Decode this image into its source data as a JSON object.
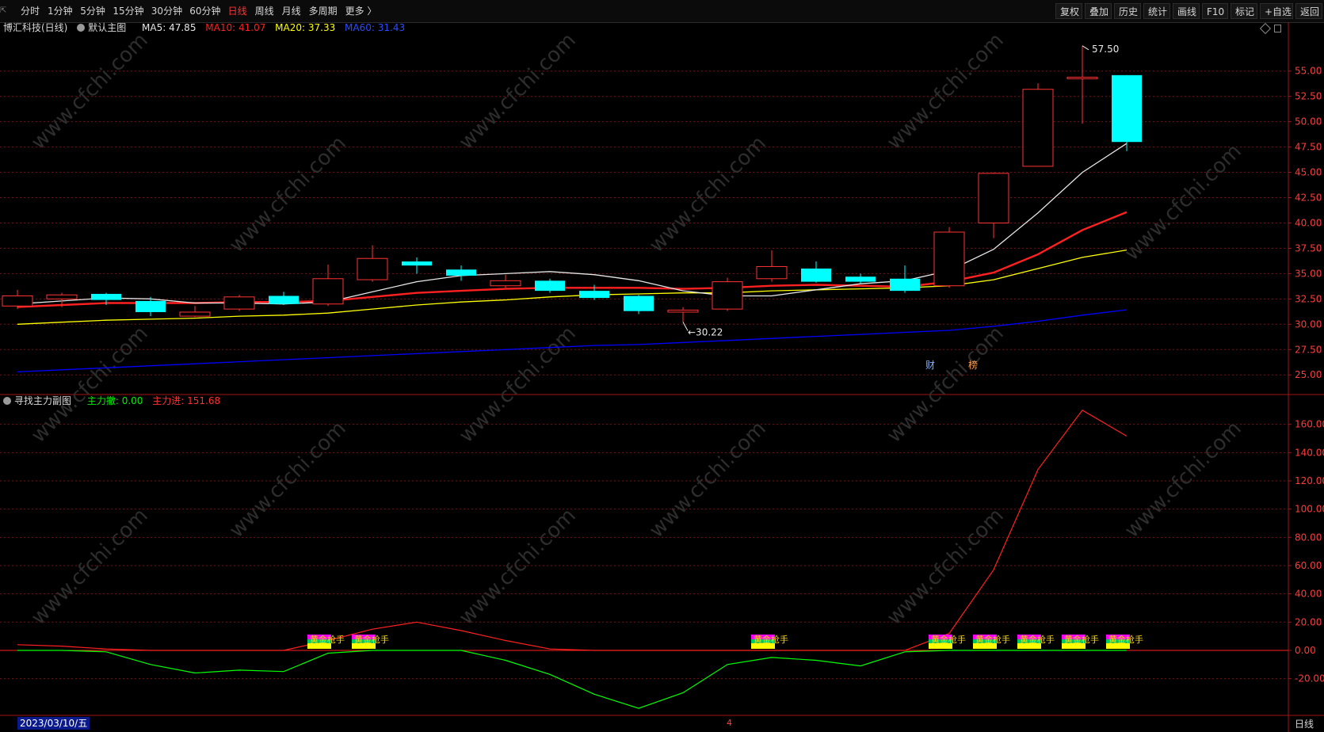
{
  "toolbar": {
    "left_items": [
      "分时",
      "1分钟",
      "5分钟",
      "15分钟",
      "30分钟",
      "60分钟",
      "日线",
      "周线",
      "月线",
      "多周期",
      "更多 〉"
    ],
    "active": "日线",
    "right_items": [
      "复权",
      "叠加",
      "历史",
      "统计",
      "画线",
      "F10",
      "标记",
      "+自选",
      "返回"
    ]
  },
  "main_chart": {
    "title": "博汇科技(日线)",
    "template": "默认主图",
    "ma5": "MA5: 47.85",
    "ma10": "MA10: 41.07",
    "ma20": "MA20: 37.33",
    "ma60": "MA60: 31.43",
    "high_label": "57.50",
    "low_label": "30.22",
    "event_badges": [
      "财",
      "榜"
    ],
    "y_ticks": [
      "55.00",
      "52.50",
      "50.00",
      "47.50",
      "45.00",
      "42.50",
      "40.00",
      "37.50",
      "35.00",
      "32.50",
      "30.00",
      "27.50",
      "25.00"
    ]
  },
  "sub_chart": {
    "title": "寻找主力副图",
    "out_label": "主力撤: 0.00",
    "in_label": "主力进: 151.68",
    "signal_text": "黄金枪手",
    "y_ticks": [
      "160.00",
      "140.00",
      "120.00",
      "100.00",
      "80.00",
      "60.00",
      "40.00",
      "20.00",
      "0.00",
      "-20.00"
    ]
  },
  "bottom": {
    "date": "2023/03/10/五",
    "marker": "4",
    "period": "日线"
  },
  "watermark": "www.cfchi.com",
  "colors": {
    "up": "#ff3333",
    "down": "#00ffff",
    "ma5": "#e6e6e6",
    "ma10": "#ff2020",
    "ma20": "#ffff00",
    "ma60": "#0000ff",
    "grid": "#7a1010",
    "in_line": "#ff2020",
    "out_line": "#00ff00"
  },
  "chart_data": [
    {
      "type": "candlestick",
      "title": "博汇科技(日线)",
      "candles": [
        {
          "o": 31.8,
          "h": 33.4,
          "l": 31.5,
          "c": 32.8
        },
        {
          "o": 32.5,
          "h": 33.1,
          "l": 31.7,
          "c": 32.9
        },
        {
          "o": 33.0,
          "h": 33.1,
          "l": 31.9,
          "c": 32.4
        },
        {
          "o": 32.3,
          "h": 32.7,
          "l": 30.8,
          "c": 31.2
        },
        {
          "o": 30.8,
          "h": 31.8,
          "l": 30.7,
          "c": 31.2
        },
        {
          "o": 31.5,
          "h": 32.9,
          "l": 31.3,
          "c": 32.7
        },
        {
          "o": 32.8,
          "h": 33.2,
          "l": 31.9,
          "c": 32.0
        },
        {
          "o": 32.0,
          "h": 35.9,
          "l": 31.8,
          "c": 34.5
        },
        {
          "o": 34.4,
          "h": 37.8,
          "l": 34.2,
          "c": 36.5
        },
        {
          "o": 36.2,
          "h": 36.6,
          "l": 35.0,
          "c": 35.8
        },
        {
          "o": 35.4,
          "h": 35.8,
          "l": 34.3,
          "c": 34.8
        },
        {
          "o": 33.8,
          "h": 34.9,
          "l": 33.6,
          "c": 34.3
        },
        {
          "o": 34.3,
          "h": 34.5,
          "l": 33.1,
          "c": 33.3
        },
        {
          "o": 33.3,
          "h": 33.9,
          "l": 32.4,
          "c": 32.6
        },
        {
          "o": 32.8,
          "h": 32.9,
          "l": 31.0,
          "c": 31.3
        },
        {
          "o": 31.2,
          "h": 31.7,
          "l": 30.22,
          "c": 31.4
        },
        {
          "o": 31.5,
          "h": 34.6,
          "l": 31.3,
          "c": 34.2
        },
        {
          "o": 34.5,
          "h": 37.3,
          "l": 34.2,
          "c": 35.7
        },
        {
          "o": 35.5,
          "h": 36.2,
          "l": 34.1,
          "c": 34.2
        },
        {
          "o": 34.7,
          "h": 35.0,
          "l": 34.0,
          "c": 34.2
        },
        {
          "o": 34.5,
          "h": 35.8,
          "l": 33.1,
          "c": 33.3
        },
        {
          "o": 33.8,
          "h": 39.6,
          "l": 33.6,
          "c": 39.1
        },
        {
          "o": 40.0,
          "h": 45.0,
          "l": 38.5,
          "c": 44.9
        },
        {
          "o": 45.6,
          "h": 53.8,
          "l": 45.6,
          "c": 53.2
        },
        {
          "o": 54.4,
          "h": 57.5,
          "l": 49.8,
          "c": 54.4
        },
        {
          "o": 54.6,
          "h": 54.6,
          "l": 47.1,
          "c": 48.0
        }
      ],
      "ma5": [
        32.0,
        32.3,
        32.6,
        32.5,
        32.1,
        32.1,
        32.0,
        32.2,
        33.2,
        34.2,
        34.8,
        35.0,
        35.2,
        34.9,
        34.3,
        33.3,
        32.8,
        32.8,
        33.4,
        34.0,
        34.3,
        35.3,
        37.4,
        41.0,
        45.0,
        47.85
      ],
      "ma10": [
        31.7,
        31.9,
        32.1,
        32.1,
        32.1,
        32.2,
        32.2,
        32.3,
        32.7,
        33.1,
        33.3,
        33.5,
        33.6,
        33.6,
        33.6,
        33.5,
        33.6,
        33.8,
        33.9,
        33.8,
        33.7,
        34.2,
        35.1,
        36.9,
        39.3,
        41.07
      ],
      "ma20": [
        30.0,
        30.2,
        30.4,
        30.5,
        30.6,
        30.8,
        30.9,
        31.1,
        31.5,
        31.9,
        32.2,
        32.4,
        32.7,
        32.9,
        33.0,
        33.1,
        33.1,
        33.3,
        33.4,
        33.5,
        33.6,
        33.8,
        34.4,
        35.5,
        36.6,
        37.33
      ],
      "ma60": [
        25.3,
        25.5,
        25.7,
        25.9,
        26.1,
        26.3,
        26.5,
        26.7,
        26.9,
        27.1,
        27.3,
        27.5,
        27.7,
        27.9,
        28.0,
        28.2,
        28.4,
        28.6,
        28.8,
        29.0,
        29.2,
        29.4,
        29.8,
        30.3,
        30.9,
        31.43
      ],
      "y_range": [
        24.0,
        58.5
      ]
    },
    {
      "type": "line",
      "title": "寻找主力副图",
      "series": [
        {
          "name": "主力进",
          "values": [
            4,
            3,
            1,
            0,
            0,
            0,
            0,
            7,
            15,
            20,
            14,
            7,
            1,
            0,
            0,
            0,
            0,
            0,
            0,
            0,
            0,
            12,
            57,
            128,
            170,
            151.68
          ]
        },
        {
          "name": "主力撤",
          "values": [
            0,
            0,
            -1,
            -10,
            -16,
            -14,
            -15,
            -2,
            0,
            0,
            0,
            -7,
            -17,
            -31,
            -41,
            -30,
            -10,
            -5,
            -7,
            -11,
            -1,
            0,
            0,
            0,
            0,
            0
          ]
        }
      ],
      "signal_bars": [
        7,
        8,
        17,
        21,
        22,
        23,
        24,
        25
      ],
      "y_range": [
        -46,
        180
      ]
    }
  ]
}
